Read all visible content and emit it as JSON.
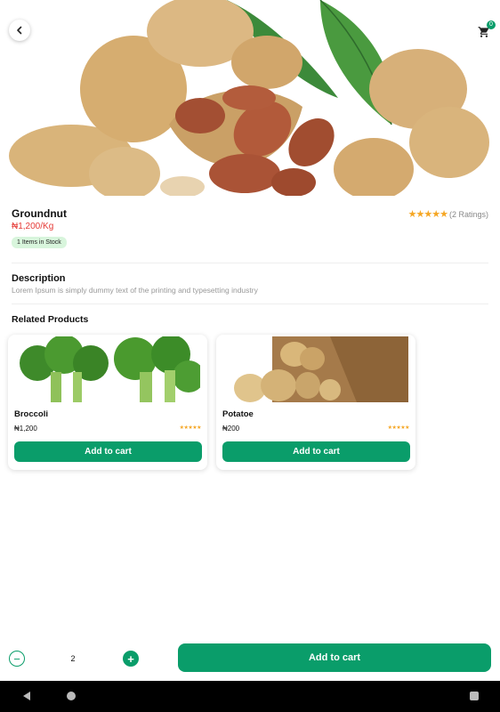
{
  "product": {
    "name": "Groundnut",
    "price": "₦1,200/Kg",
    "stars": "★★★★★",
    "ratings": "(2 Ratings)",
    "stock": "1 Items in Stock",
    "image_icon": "groundnut-photo"
  },
  "header": {
    "back_icon": "chevron-left-icon",
    "cart_icon": "cart-icon",
    "cart_count": "0"
  },
  "description": {
    "title": "Description",
    "text": "Lorem Ipsum is simply dummy text of the printing and typesetting industry"
  },
  "related": {
    "title": "Related Products",
    "items": [
      {
        "name": "Broccoli",
        "price": "₦1,200",
        "stars": "★★★★★",
        "button": "Add to cart"
      },
      {
        "name": "Potatoe",
        "price": "₦200",
        "stars": "★★★★★",
        "button": "Add to cart"
      }
    ]
  },
  "bottom_bar": {
    "quantity": "2",
    "minus": "−",
    "plus": "+",
    "add_button": "Add to cart"
  },
  "colors": {
    "accent": "#0a9d6a",
    "price": "#e53935",
    "star": "#f5a623",
    "stock_bg": "#d8f5dc"
  }
}
